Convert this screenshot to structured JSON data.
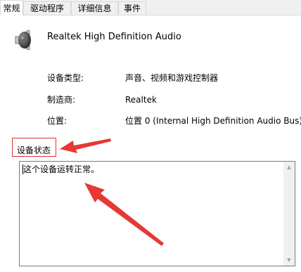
{
  "tabs": [
    {
      "label": "常规",
      "active": true
    },
    {
      "label": "驱动程序",
      "active": false
    },
    {
      "label": "详细信息",
      "active": false
    },
    {
      "label": "事件",
      "active": false
    }
  ],
  "device": {
    "name": "Realtek High Definition Audio",
    "icon": "speaker-icon"
  },
  "properties": [
    {
      "label": "设备类型:",
      "value": "声音、视频和游戏控制器"
    },
    {
      "label": "制造商:",
      "value": "Realtek"
    },
    {
      "label": "位置:",
      "value": "位置 0 (Internal High Definition Audio Bus)"
    }
  ],
  "status": {
    "group_label": "设备状态",
    "text": "这个设备运转正常。"
  },
  "colors": {
    "annotation_red": "#e03030",
    "tab_bg": "#f0f0f0",
    "border": "#d9d9d9"
  }
}
